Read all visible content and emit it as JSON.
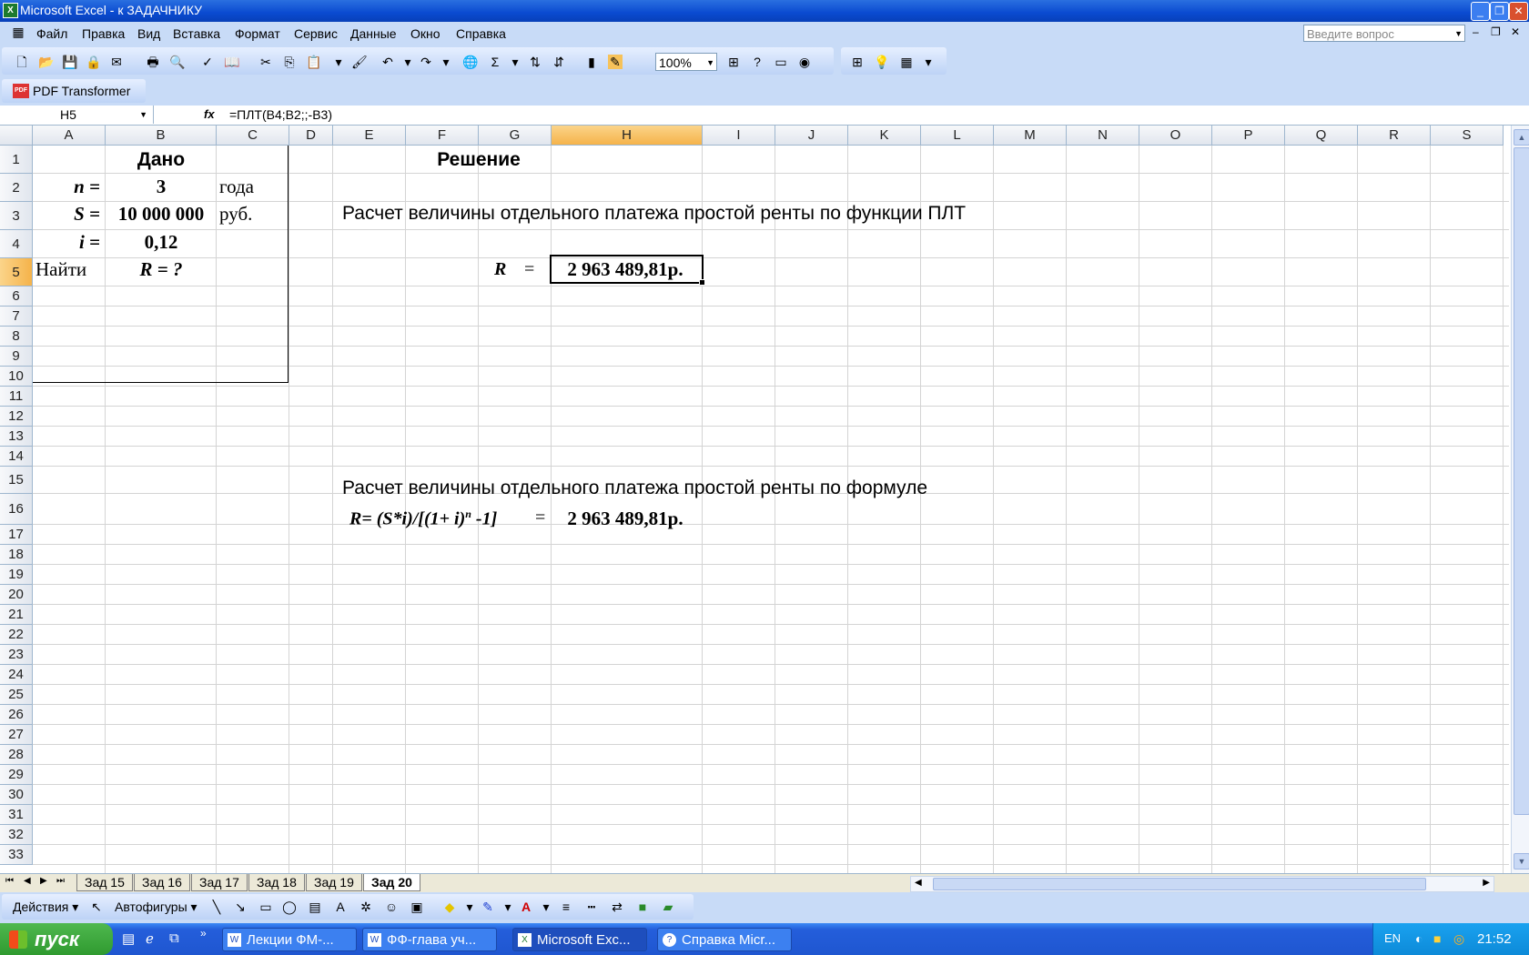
{
  "window": {
    "title": "Microsoft Excel - к ЗАДАЧНИКУ",
    "app_icon": "excel-icon"
  },
  "menu": [
    "Файл",
    "Правка",
    "Вид",
    "Вставка",
    "Формат",
    "Сервис",
    "Данные",
    "Окно",
    "Справка"
  ],
  "ask_box": {
    "placeholder": "Введите вопрос"
  },
  "toolbar": {
    "zoom": "100%"
  },
  "pdf_toolbar": {
    "label": "PDF Transformer"
  },
  "formula_bar": {
    "name_box": "H5",
    "fx": "fx",
    "formula": "=ПЛТ(B4;B2;;-B3)"
  },
  "columns": [
    "A",
    "B",
    "C",
    "D",
    "E",
    "F",
    "G",
    "H",
    "I",
    "J",
    "K",
    "L",
    "M",
    "N",
    "O",
    "P",
    "Q",
    "R",
    "S"
  ],
  "selected_cell": {
    "column": "H",
    "row": 5
  },
  "cells": {
    "B1": "Дано",
    "F1": "Решение",
    "A2": "n =",
    "B2": "3",
    "C2": "года",
    "A3": "S =",
    "B3": "10 000 000",
    "C3": "руб.",
    "A4": "i =",
    "B4": "0,12",
    "A5": "Найти",
    "B5": "R = ?",
    "E3": "Расчет величины отдельного платежа простой ренты по функции ПЛТ",
    "G5a": "R",
    "G5b": "=",
    "H5": "2 963 489,81р.",
    "E15": "Расчет величины отдельного платежа простой ренты по формуле",
    "E16": "R= (S*i)/[(1+ i)",
    "E16_sup": "n",
    "E16_tail": " -1]",
    "G16": "=",
    "H16": "2 963 489,81р."
  },
  "sheet_tabs": [
    "Зад 15",
    "Зад 16",
    "Зад 17",
    "Зад 18",
    "Зад 19",
    "Зад 20"
  ],
  "active_tab": "Зад 20",
  "drawing_toolbar": {
    "actions": "Действия",
    "autoshapes": "Автофигуры"
  },
  "taskbar": {
    "start": "пуск",
    "buttons": [
      "Лекции ФМ-...",
      "ФФ-глава уч...",
      "Microsoft Exc...",
      "Справка Micr..."
    ],
    "lang": "EN",
    "clock": "21:52"
  }
}
